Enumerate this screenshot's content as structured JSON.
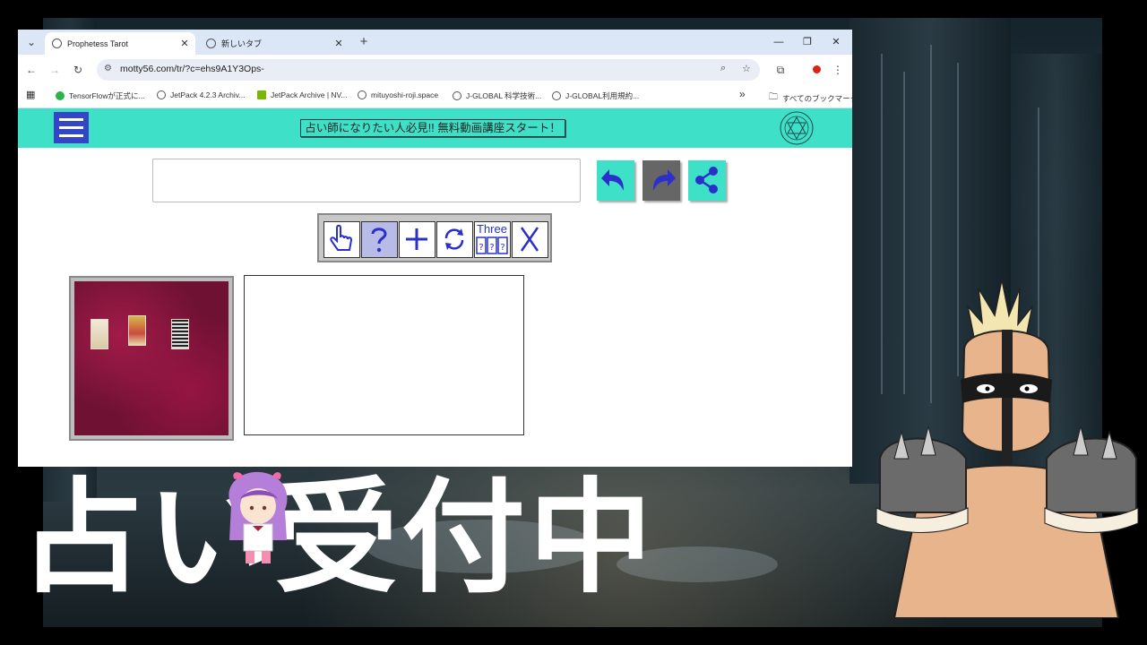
{
  "browser": {
    "tabs": [
      {
        "title": "Prophetess Tarot",
        "active": true
      },
      {
        "title": "新しいタブ",
        "active": false
      }
    ],
    "new_tab_symbol": "+",
    "window_controls": {
      "minimize": "—",
      "restore": "❐",
      "close": "✕"
    },
    "url": "motty56.com/tr/?c=ehs9A1Y3Ops-",
    "bookmarks": [
      "TensorFlowが正式に...",
      "JetPack 4.2.3 Archiv...",
      "JetPack Archive | NV...",
      "mituyoshi-roji.space",
      "J-GLOBAL 科学技術...",
      "J-GLOBAL利用規約..."
    ],
    "bookmarks_overflow": "»",
    "all_bookmarks": "すべてのブックマーク"
  },
  "site": {
    "banner": "占い師になりたい人必見!! 無料動画講座スタート！",
    "question_value": "",
    "reading_value": "",
    "tool_three_label": "Three",
    "colors": {
      "header": "#3fe0c8",
      "menu": "#3347c6",
      "cloth": "#6e1132",
      "tool_icon": "#2a30c9"
    }
  },
  "overlay": {
    "caption": "占い受付中"
  }
}
